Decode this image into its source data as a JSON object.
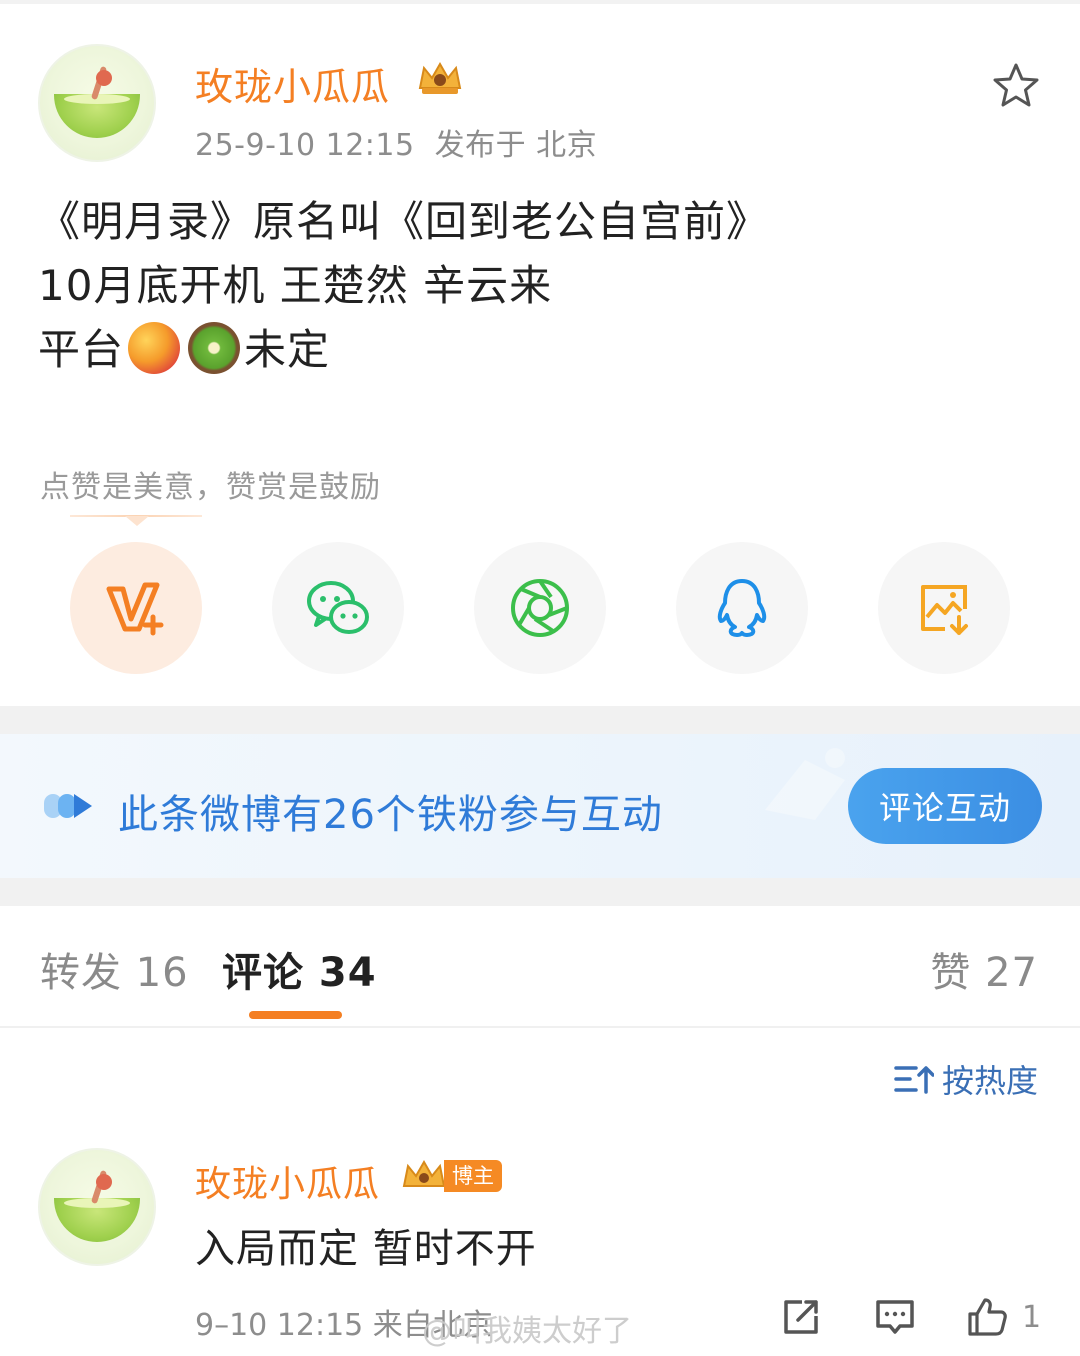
{
  "post": {
    "author": "玫珑小瓜瓜",
    "time": "25-9-10 12:15",
    "location": "发布于 北京",
    "lines": [
      "《明月录》原名叫《回到老公自宫前》",
      "10月底开机 王楚然 辛云来",
      "平台",
      "未定"
    ]
  },
  "reward": {
    "text": "点赞是美意，赞赏是鼓励"
  },
  "share": {
    "items": [
      {
        "icon": "v-plus-icon"
      },
      {
        "icon": "wechat-icon"
      },
      {
        "icon": "moments-icon"
      },
      {
        "icon": "qq-icon"
      },
      {
        "icon": "save-image-icon"
      }
    ]
  },
  "banner": {
    "text": "此条微博有26个铁粉参与互动",
    "button": "评论互动"
  },
  "tabs": {
    "repost": "转发 16",
    "comment": "评论 34",
    "like": "赞 27"
  },
  "sort": {
    "label": "按热度"
  },
  "comment": {
    "author": "玫珑小瓜瓜",
    "badge": "博主",
    "text": "入局而定 暂时不开",
    "meta": "9–10 12:15  来自北京",
    "like_count": "1"
  },
  "watermark": "@叫我姨太好了",
  "colors": {
    "accent": "#f47f23",
    "link": "#2f7bd8",
    "button": "#3b8ee3"
  }
}
